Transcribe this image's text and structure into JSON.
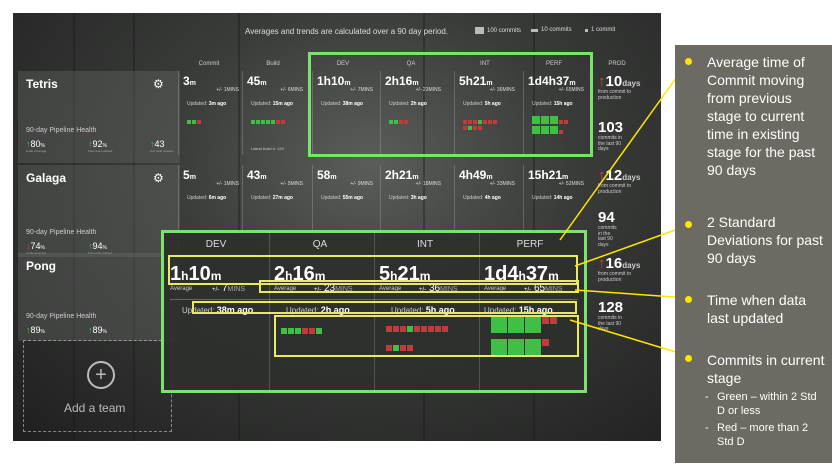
{
  "header": {
    "note": "Averages and trends are calculated over a 90 day period.",
    "legend": [
      "100 commits",
      "10 commits",
      "1 commit"
    ]
  },
  "columns": [
    "Commit",
    "Build",
    "DEV",
    "QA",
    "INT",
    "PERF",
    "PROD"
  ],
  "teams": [
    {
      "name": "Tetris",
      "health_label": "90-day Pipeline Health",
      "health": [
        {
          "value": "80",
          "unit": "%",
          "label": "Code coverage",
          "trend": "up"
        },
        {
          "value": "92",
          "unit": "%",
          "label": "Func tests passed",
          "trend": "up"
        },
        {
          "value": "43",
          "unit": "",
          "label": "# of code reviews",
          "trend": "up"
        }
      ],
      "stages": [
        {
          "value": "3",
          "unit": "m",
          "sd": "+/- 1MINS",
          "updated": "3m ago"
        },
        {
          "value": "45",
          "unit": "m",
          "sd": "+/- 6MINS",
          "updated": "15m ago"
        },
        {
          "value": "1h10",
          "unit": "m",
          "sd": "+/- 7MINS",
          "updated": "38m ago"
        },
        {
          "value": "2h16",
          "unit": "m",
          "sd": "+/- 23MINS",
          "updated": "2h ago"
        },
        {
          "value": "5h21",
          "unit": "m",
          "sd": "+/- 36MINS",
          "updated": "5h ago"
        },
        {
          "value": "1d4h37",
          "unit": "m",
          "sd": "+/- 65MINS",
          "updated": "15h ago"
        }
      ],
      "build_note": "Latest build #: 129",
      "prod": [
        {
          "value": "10",
          "unit": "days",
          "label": "from commit to production",
          "trend": "up"
        },
        {
          "value": "103",
          "unit": "",
          "label": "commits in the last 90 days",
          "trend": ""
        }
      ]
    },
    {
      "name": "Galaga",
      "health_label": "90-day Pipeline Health",
      "health": [
        {
          "value": "74",
          "unit": "%",
          "label": "Code coverage",
          "trend": "down"
        },
        {
          "value": "94",
          "unit": "%",
          "label": "Func tests passed",
          "trend": "up"
        },
        {
          "value": "",
          "unit": "",
          "label": "",
          "trend": ""
        }
      ],
      "stages": [
        {
          "value": "5",
          "unit": "m",
          "sd": "+/- 1MINS",
          "updated": "6m ago"
        },
        {
          "value": "43",
          "unit": "m",
          "sd": "+/- 5MINS",
          "updated": "27m ago"
        },
        {
          "value": "58",
          "unit": "m",
          "sd": "+/- 9MINS",
          "updated": "55m ago"
        },
        {
          "value": "2h21",
          "unit": "m",
          "sd": "+/- 18MINS",
          "updated": "3h ago"
        },
        {
          "value": "4h49",
          "unit": "m",
          "sd": "+/- 33MINS",
          "updated": "4h ago"
        },
        {
          "value": "15h21",
          "unit": "m",
          "sd": "+/- 52MINS",
          "updated": "14h ago"
        }
      ],
      "prod": [
        {
          "value": "12",
          "unit": "days",
          "label": "from commit to production",
          "trend": "up"
        },
        {
          "value": "94",
          "unit": "",
          "label": "commits in the last 90 days",
          "trend": ""
        }
      ]
    },
    {
      "name": "Pong",
      "health_label": "90-day Pipeline Health",
      "health": [
        {
          "value": "89",
          "unit": "%",
          "label": "Code coverage",
          "trend": "up"
        },
        {
          "value": "89",
          "unit": "%",
          "label": "Func tests passed",
          "trend": "up"
        },
        {
          "value": "",
          "unit": "",
          "label": "",
          "trend": ""
        }
      ],
      "prod": [
        {
          "value": "16",
          "unit": "days",
          "label": "from commit to production",
          "trend": "up"
        },
        {
          "value": "128",
          "unit": "",
          "label": "commits in the last 90 days",
          "trend": ""
        }
      ]
    }
  ],
  "add_team": "Add a team",
  "zoom": {
    "stages": [
      {
        "name": "DEV",
        "hours": "1",
        "h": "h",
        "mins": "10",
        "m": "m",
        "avg": "Average",
        "sd_prefix": "+/-",
        "sd": "7",
        "sd_unit": "MINS",
        "updated_label": "Updated:",
        "updated": "38m ago"
      },
      {
        "name": "QA",
        "hours": "2",
        "h": "h",
        "mins": "16",
        "m": "m",
        "avg": "Average",
        "sd_prefix": "+/-",
        "sd": "23",
        "sd_unit": "MINS",
        "updated_label": "Updated:",
        "updated": "2h ago"
      },
      {
        "name": "INT",
        "hours": "5",
        "h": "h",
        "mins": "21",
        "m": "m",
        "avg": "Average",
        "sd_prefix": "+/-",
        "sd": "36",
        "sd_unit": "MINS",
        "updated_label": "Updated:",
        "updated": "5h ago"
      },
      {
        "name": "PERF",
        "hours": "1d4",
        "h": "h",
        "mins": "37",
        "m": "m",
        "avg": "Average",
        "sd_prefix": "+/-",
        "sd": "65",
        "sd_unit": "MINS",
        "updated_label": "Updated:",
        "updated": "15h ago"
      }
    ]
  },
  "annotations": [
    "Average time of Commit moving from previous stage to current time in existing stage for the past 90 days",
    "2 Standard Deviations for past 90 days",
    "Time when data last updated",
    "Commits in current stage"
  ],
  "sub_notes": [
    {
      "dash": "-",
      "text": "Green – within 2 Std D or less"
    },
    {
      "dash": "-",
      "text": "Red – more than 2 Std D"
    }
  ],
  "colors": {
    "green": "#3fbf46",
    "red": "#c4393b",
    "highlight_green": "#79e36b",
    "highlight_yellow": "#eaeb5a",
    "panel": "#6d6a63"
  }
}
